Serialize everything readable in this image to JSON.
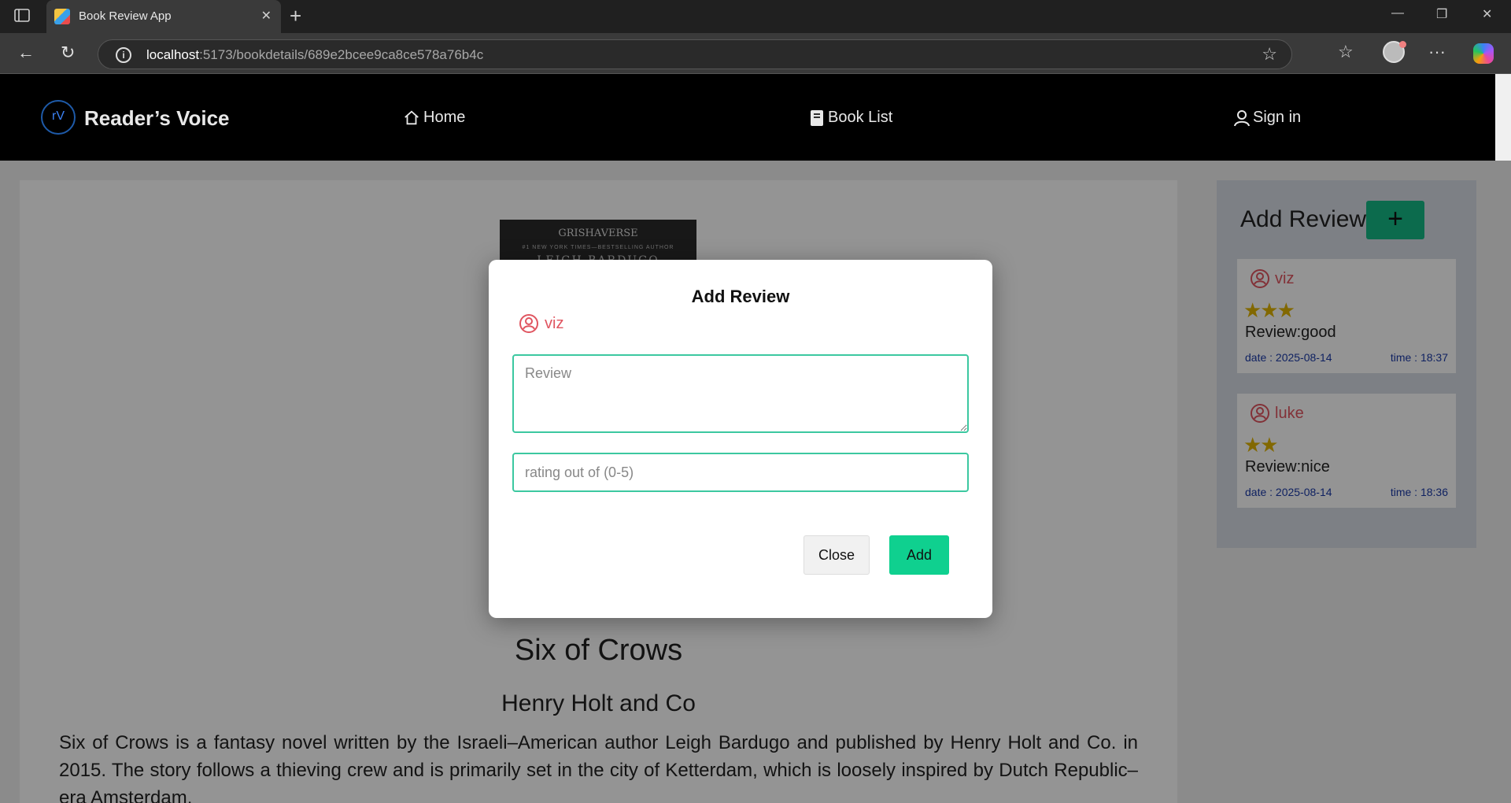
{
  "browser": {
    "tab_title": "Book Review App",
    "url_host": "localhost",
    "url_path": ":5173/bookdetails/689e2bcee9ca8ce578a76b4c"
  },
  "site": {
    "logo_mark": "rV",
    "logo_text": "Reader’s Voice",
    "nav": {
      "home": "Home",
      "book_list": "Book List",
      "sign_in": "Sign in"
    }
  },
  "book": {
    "cover_line1": "GRISHAVERSE",
    "cover_line2": "#1 NEW YORK TIMES—BESTSELLING AUTHOR",
    "cover_line3": "LEIGH BARDUGO",
    "title": "Six of Crows",
    "publisher": "Henry Holt and Co",
    "description": "Six of Crows is a fantasy novel written by the Israeli–American author Leigh Bardugo and published by Henry Holt and Co. in 2015. The story follows a thieving crew and is primarily set in the city of Ketterdam, which is loosely inspired by Dutch Republic–era Amsterdam."
  },
  "sidebar": {
    "heading": "Add Review",
    "add_button": "+",
    "reviews": [
      {
        "user": "viz",
        "rating": 3,
        "stars": "★★★",
        "text": "Review:good",
        "date": "date : 2025-08-14",
        "time": "time : 18:37"
      },
      {
        "user": "luke",
        "rating": 2,
        "stars": "★★",
        "text": "Review:nice",
        "date": "date : 2025-08-14",
        "time": "time : 18:36"
      }
    ]
  },
  "modal": {
    "title": "Add Review",
    "user": "viz",
    "review_placeholder": "Review",
    "rating_placeholder": "rating out of (0-5)",
    "close_label": "Close",
    "add_label": "Add"
  },
  "colors": {
    "accent_green": "#0fd08f",
    "user_red": "#e05560",
    "star_gold": "#e0b400",
    "meta_blue": "#1a3aa8"
  }
}
